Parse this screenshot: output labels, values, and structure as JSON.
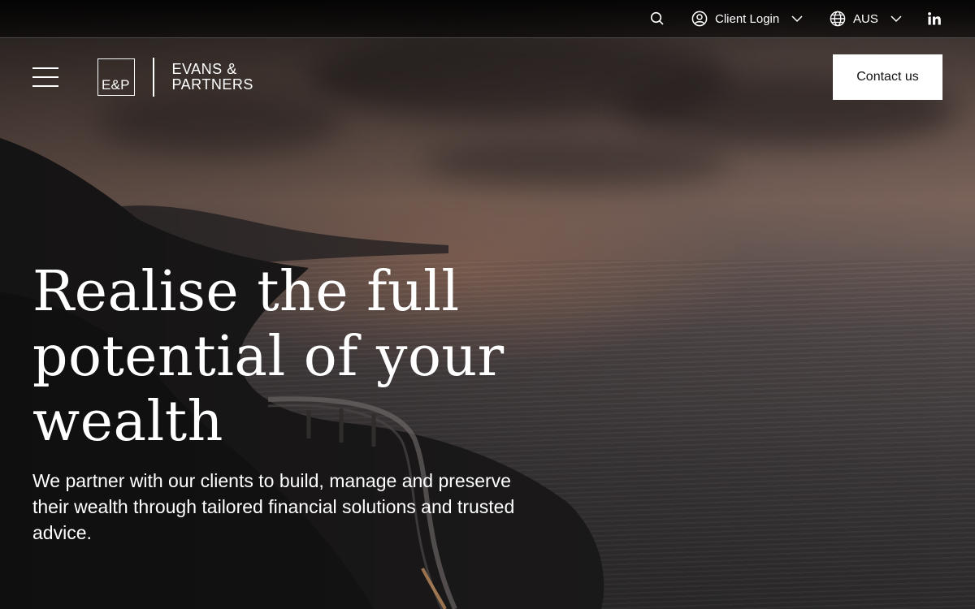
{
  "utility": {
    "search_icon": "search-icon",
    "client_login_label": "Client Login",
    "region_label": "AUS",
    "linkedin_icon": "linkedin-icon"
  },
  "nav": {
    "menu_icon": "hamburger-icon",
    "logo_mark": "E&P",
    "logo_line1": "EVANS &",
    "logo_line2": "PARTNERS",
    "contact_label": "Contact us"
  },
  "hero": {
    "title": "Realise the full potential of your wealth",
    "subtitle": "We partner with our clients to build, manage and preserve their wealth through tailored financial solutions and trusted advice."
  },
  "colors": {
    "button_bg": "#ffffff",
    "button_text": "#111111",
    "text": "#ffffff"
  }
}
